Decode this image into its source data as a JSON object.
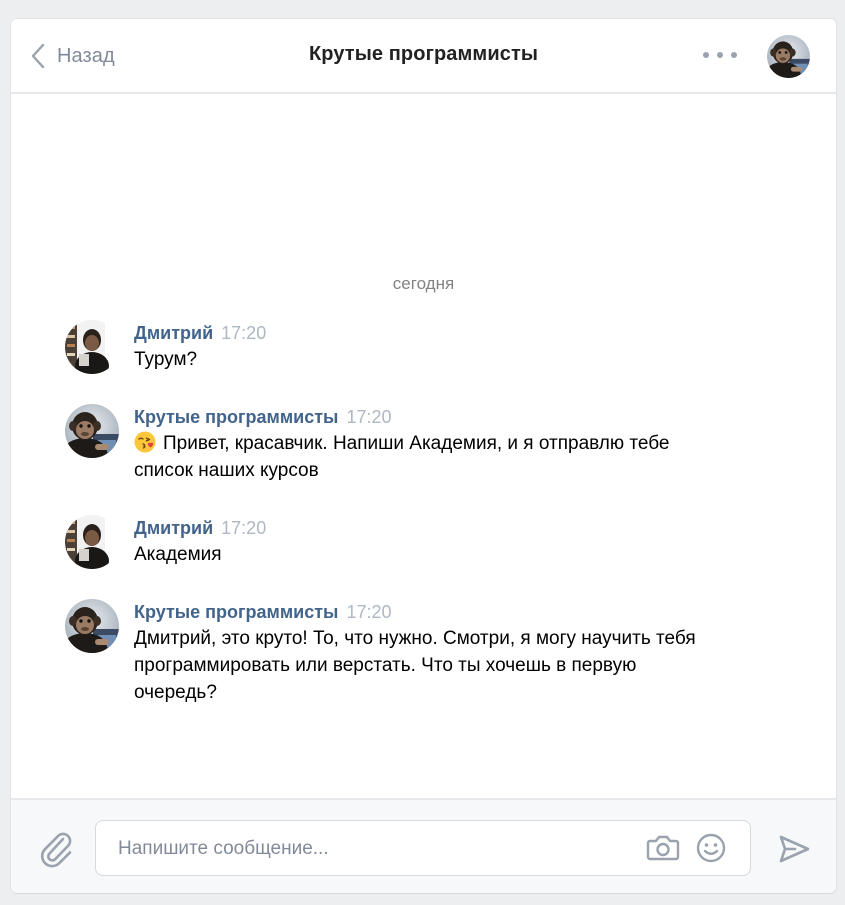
{
  "header": {
    "back_label": "Назад",
    "title": "Крутые программисты"
  },
  "chat": {
    "date_separator": "сегодня",
    "messages": [
      {
        "author": "Дмитрий",
        "time": "17:20",
        "avatar": "man-photo-avatar",
        "lines": [
          "Турум?"
        ]
      },
      {
        "author": "Крутые программисты",
        "time": "17:20",
        "avatar": "chimp-avatar",
        "emoji": "kiss-emoji",
        "lines": [
          "Привет, красавчик. Напиши Академия, и я отправлю тебе",
          "список наших курсов"
        ]
      },
      {
        "author": "Дмитрий",
        "time": "17:20",
        "avatar": "man-photo-avatar",
        "lines": [
          "Академия"
        ]
      },
      {
        "author": "Крутые программисты",
        "time": "17:20",
        "avatar": "chimp-avatar",
        "lines": [
          "Дмитрий, это круто! То, что нужно. Смотри, я могу научить тебя",
          "программировать или верстать. Что ты хочешь в первую",
          "очередь?"
        ]
      }
    ]
  },
  "composer": {
    "placeholder": "Напишите сообщение..."
  },
  "colors": {
    "author_link": "#42648b",
    "time": "#aeb7c2",
    "icon_gray": "#99a2ad",
    "page_bg": "#edeef0"
  }
}
